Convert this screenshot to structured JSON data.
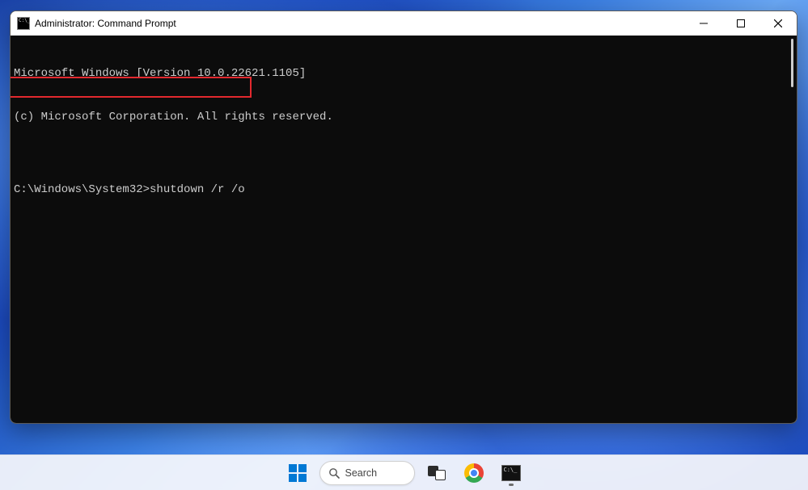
{
  "window": {
    "title": "Administrator: Command Prompt"
  },
  "terminal": {
    "line1": "Microsoft Windows [Version 10.0.22621.1105]",
    "line2": "(c) Microsoft Corporation. All rights reserved.",
    "blank": "",
    "prompt": "C:\\Windows\\System32>",
    "command": "shutdown /r /o"
  },
  "taskbar": {
    "search_label": "Search"
  }
}
